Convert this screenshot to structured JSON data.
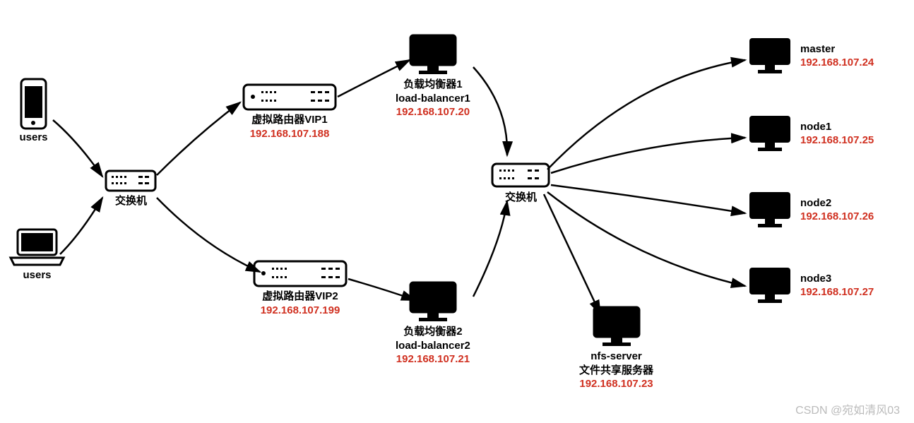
{
  "users1": {
    "label": "users"
  },
  "users2": {
    "label": "users"
  },
  "switch1": {
    "label": "交换机"
  },
  "switch2": {
    "label": "交换机"
  },
  "vip1": {
    "label": "虚拟路由器VIP1",
    "ip": "192.168.107.188"
  },
  "vip2": {
    "label": "虚拟路由器VIP2",
    "ip": "192.168.107.199"
  },
  "lb1": {
    "line1": "负载均衡器1",
    "line2": "load-balancer1",
    "ip": "192.168.107.20"
  },
  "lb2": {
    "line1": "负载均衡器2",
    "line2": "load-balancer2",
    "ip": "192.168.107.21"
  },
  "nfs": {
    "line1": "nfs-server",
    "line2": "文件共享服务器",
    "ip": "192.168.107.23"
  },
  "master": {
    "label": "master",
    "ip": "192.168.107.24"
  },
  "node1": {
    "label": "node1",
    "ip": "192.168.107.25"
  },
  "node2": {
    "label": "node2",
    "ip": "192.168.107.26"
  },
  "node3": {
    "label": "node3",
    "ip": "192.168.107.27"
  },
  "watermark": "CSDN @宛如清风03"
}
